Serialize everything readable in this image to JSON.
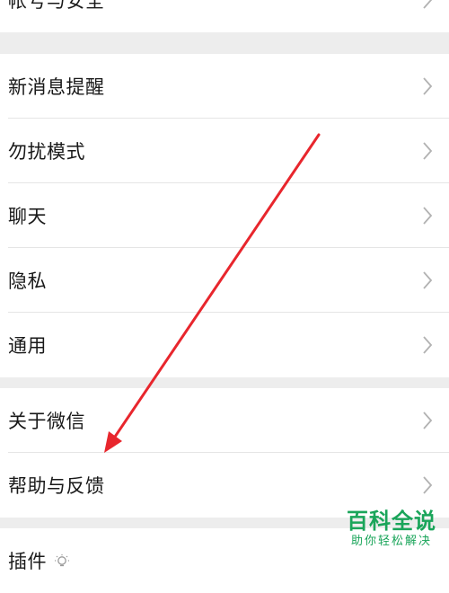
{
  "settings": {
    "account_security": "帐号与安全",
    "new_message_alerts": "新消息提醒",
    "do_not_disturb": "勿扰模式",
    "chat": "聊天",
    "privacy": "隐私",
    "general": "通用",
    "about_wechat": "关于微信",
    "help_feedback": "帮助与反馈",
    "plugins": "插件"
  },
  "icons": {
    "chevron": "chevron-right-icon",
    "plugin": "lightbulb-icon"
  },
  "watermark": {
    "title": "百科全说",
    "subtitle": "助你轻松解决"
  },
  "colors": {
    "background": "#ededed",
    "row": "#ffffff",
    "annotation_arrow": "#e8262d",
    "watermark": "#1aa55a"
  }
}
